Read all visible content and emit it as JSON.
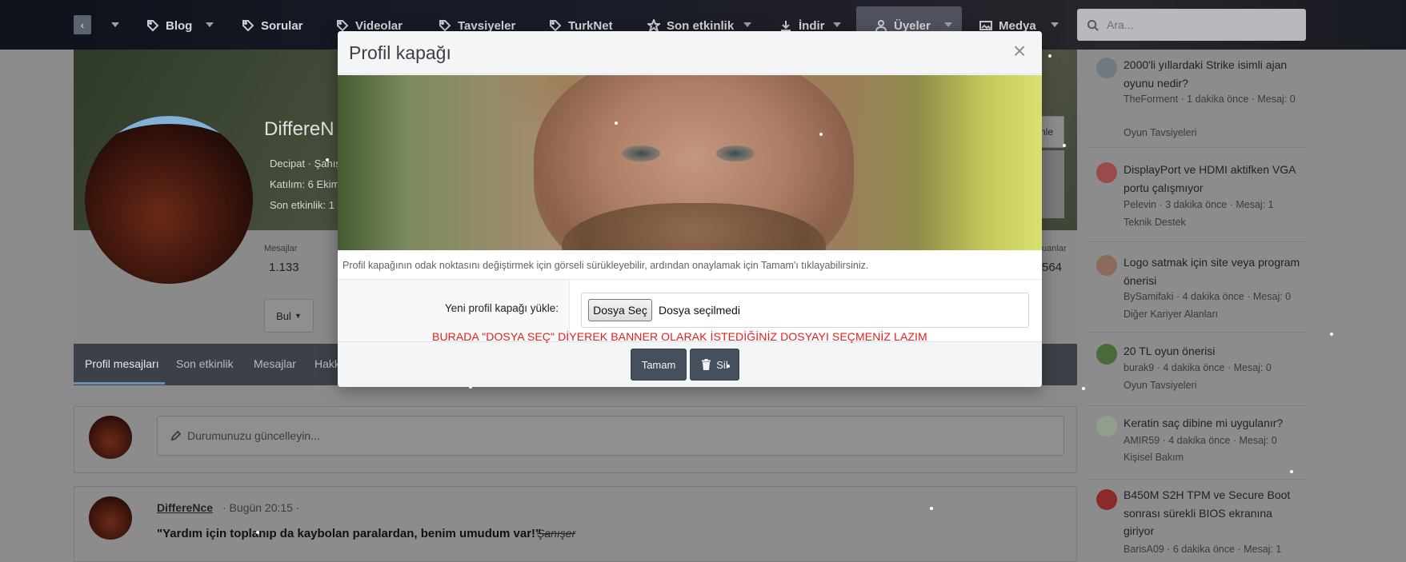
{
  "nav": {
    "items": [
      {
        "label": "Blog",
        "icon": "tag-icon"
      },
      {
        "label": "Sorular",
        "icon": "tag-icon"
      },
      {
        "label": "Videolar",
        "icon": "tag-icon"
      },
      {
        "label": "Tavsiyeler",
        "icon": "tag-icon"
      },
      {
        "label": "TurkNet",
        "icon": "tag-icon"
      },
      {
        "label": "Son etkinlik",
        "icon": "star-icon"
      },
      {
        "label": "İndir",
        "icon": "download-icon"
      },
      {
        "label": "Üyeler",
        "icon": "user-icon"
      },
      {
        "label": "Medya",
        "icon": "image-icon"
      }
    ],
    "search_placeholder": "Ara..."
  },
  "profile": {
    "name": "DiffereN",
    "line1": "Decipat · Şanış",
    "line2": "Katılım: 6 Ekim",
    "line3": "Son etkinlik: 1",
    "stat_label": "Mesajlar",
    "stat_value": "1.133",
    "stat2_label": "uanlar",
    "stat2_value": "564",
    "find_button": "Bul",
    "edit_button": "nle",
    "tabs": [
      "Profil mesajları",
      "Son etkinlik",
      "Mesajlar",
      "Hakk"
    ]
  },
  "status": {
    "placeholder": "Durumunuzu güncelleyin..."
  },
  "post": {
    "user": "DiffereNce",
    "meta": "· Bugün 20:15 ·",
    "quote": "\"Yardım için toplanıp da kaybolan paralardan, benim umudum var!\" -",
    "author": "Şanışer"
  },
  "sidebar": {
    "items": [
      {
        "title": "2000'li yıllardaki Strike isimli ajan oyunu nedir?",
        "meta": "TheForment · 1 dakika önce · Mesaj: 0",
        "forum": "Oyun Tavsiyeleri",
        "avatar_color": "#6f7a80"
      },
      {
        "title": "DisplayPort ve HDMI aktifken VGA portu çalışmıyor",
        "meta": "Pelevin · 3 dakika önce · Mesaj: 1",
        "forum": "Teknik Destek",
        "avatar_color": "#9a4a4a"
      },
      {
        "title": "Logo satmak için site veya program önerisi",
        "meta": "BySamifaki · 4 dakika önce · Mesaj: 0",
        "forum": "Diğer Kariyer Alanları",
        "avatar_color": "#8a6a5a"
      },
      {
        "title": "20 TL oyun önerisi",
        "meta": "burak9 · 4 dakika önce · Mesaj: 0",
        "forum": "Oyun Tavsiyeleri",
        "avatar_color": "#4a6a3a"
      },
      {
        "title": "Keratin saç dibine mi uygulanır?",
        "meta": "AMIR59 · 4 dakika önce · Mesaj: 0",
        "forum": "Kişisel Bakım",
        "avatar_color": "#8f9f8a"
      },
      {
        "title": "B450M S2H TPM ve Secure Boot sonrası sürekli BIOS ekranına giriyor",
        "meta": "BarisA09 · 6 dakika önce · Mesaj: 1",
        "forum": "",
        "avatar_color": "#8a2a2a"
      }
    ]
  },
  "modal": {
    "title": "Profil kapağı",
    "close": "×",
    "hint": "Profil kapağının odak noktasını değiştirmek için görseli sürükleyebilir, ardından onaylamak için Tamam'ı tıklayabilirsiniz.",
    "upload_label": "Yeni profil kapağı yükle:",
    "file_button": "Dosya Seç",
    "file_status": "Dosya seçilmedi",
    "warning": "BURADA \"DOSYA SEÇ\" DİYEREK BANNER OLARAK İSTEDİĞİNİZ DOSYAYI SEÇMENİZ LAZIM",
    "ok_button": "Tamam",
    "delete_button": "Sil",
    "warning_color": "#e02020"
  }
}
